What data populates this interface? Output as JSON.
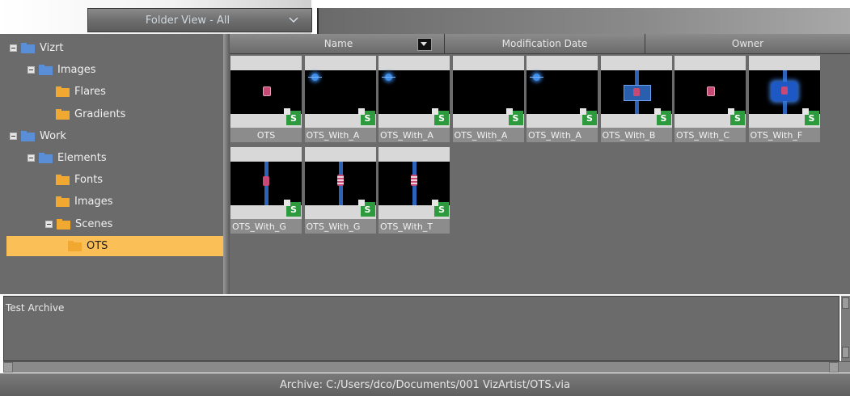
{
  "toolbar": {
    "folder_view_label": "Folder View - All",
    "dropdown_icon": "chevron-down-icon"
  },
  "tree": {
    "items": [
      {
        "label": "Vizrt",
        "level": 0,
        "expanded": true,
        "folder_color": "#5a8fd8"
      },
      {
        "label": "Images",
        "level": 1,
        "expanded": true,
        "folder_color": "#5a8fd8"
      },
      {
        "label": "Flares",
        "level": 2,
        "expanded": false,
        "folder_color": "#f0a830"
      },
      {
        "label": "Gradients",
        "level": 2,
        "expanded": false,
        "folder_color": "#f0a830"
      },
      {
        "label": "Work",
        "level": 0,
        "expanded": true,
        "folder_color": "#5a8fd8"
      },
      {
        "label": "Elements",
        "level": 1,
        "expanded": true,
        "folder_color": "#5a8fd8"
      },
      {
        "label": "Fonts",
        "level": 2,
        "expanded": false,
        "folder_color": "#f0a830"
      },
      {
        "label": "Images",
        "level": 2,
        "expanded": false,
        "folder_color": "#f0a830"
      },
      {
        "label": "Scenes",
        "level": 2,
        "expanded": true,
        "folder_color": "#f0a830"
      },
      {
        "label": "OTS",
        "level": 3,
        "expanded": false,
        "folder_color": "#f0a830",
        "selected": true
      }
    ],
    "selected_color": "#fbbf58"
  },
  "columns": {
    "name": "Name",
    "modification_date": "Modification Date",
    "owner": "Owner",
    "sort_icon": "sort-down-icon"
  },
  "thumbnails": [
    {
      "name": "OTS",
      "badge": "S",
      "graphic": "dot"
    },
    {
      "name": "OTS_With_A",
      "badge": "S",
      "graphic": "flare-top"
    },
    {
      "name": "OTS_With_A",
      "badge": "S",
      "graphic": "flare-top"
    },
    {
      "name": "OTS_With_A",
      "badge": "S",
      "graphic": "none"
    },
    {
      "name": "OTS_With_A",
      "badge": "S",
      "graphic": "flare-top"
    },
    {
      "name": "OTS_With_B",
      "badge": "S",
      "graphic": "blue-box"
    },
    {
      "name": "OTS_With_C",
      "badge": "S",
      "graphic": "dot"
    },
    {
      "name": "OTS_With_F",
      "badge": "S",
      "graphic": "blue-flare"
    },
    {
      "name": "OTS_With_G",
      "badge": "S",
      "graphic": "pole"
    },
    {
      "name": "OTS_With_G",
      "badge": "S",
      "graphic": "pole-striped"
    },
    {
      "name": "OTS_With_T",
      "badge": "S",
      "graphic": "pole-striped"
    }
  ],
  "description": {
    "text": "Test Archive"
  },
  "status": {
    "archive_path": "Archive: C:/Users/dco/Documents/001 VizArtist/OTS.via"
  }
}
